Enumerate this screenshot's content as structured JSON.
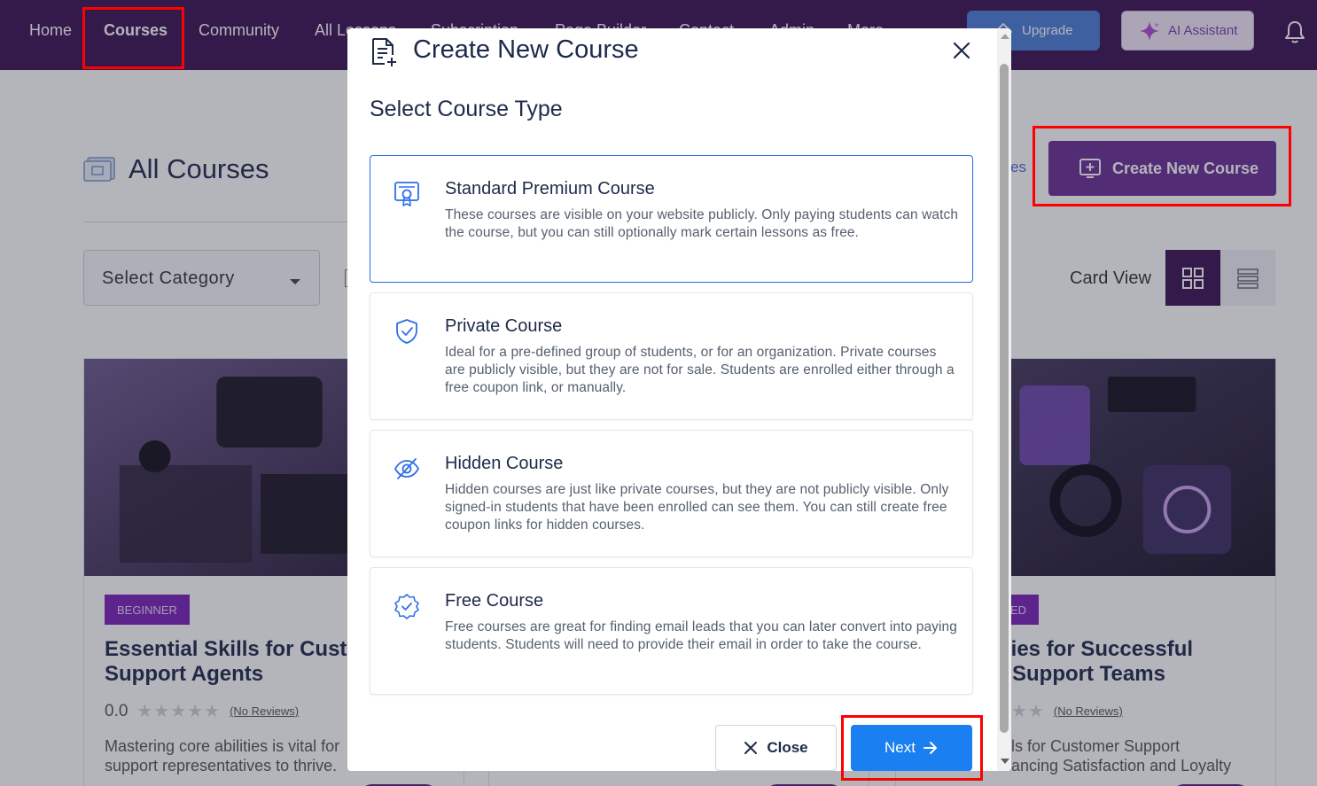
{
  "nav": {
    "items": [
      "Home",
      "Courses",
      "Community",
      "All Lessons",
      "Subscription",
      "Page Builder",
      "Contact",
      "Admin",
      "More"
    ],
    "upgrade_label": "Upgrade",
    "ai_label": "AI Assistant"
  },
  "page": {
    "title": "All Courses",
    "category_placeholder": "Select Category",
    "link_fragment": "es",
    "create_button": "Create New Course",
    "card_view_label": "Card View"
  },
  "cards": [
    {
      "badge": "BEGINNER",
      "title_line1": "Essential Skills for Cust",
      "title_line2": "Support Agents",
      "rating": "0.0",
      "reviews": "(No Reviews)",
      "desc_line1": "Mastering core abilities is vital for",
      "desc_line2": "support representatives to thrive."
    },
    {
      "badge": "ED",
      "title_line1": "ities for Successful",
      "title_line2": "r Support Teams",
      "reviews": "(No Reviews)",
      "desc_line1": "ls for Customer Support",
      "desc_line2": "ancing Satisfaction and Loyalty"
    }
  ],
  "modal": {
    "title": "Create New Course",
    "section_title": "Select Course Type",
    "options": [
      {
        "title": "Standard Premium Course",
        "desc": "These courses are visible on your website publicly. Only paying students can watch the course, but you can still optionally mark certain lessons as free.",
        "icon": "certificate-icon",
        "selected": true
      },
      {
        "title": "Private Course",
        "desc": "Ideal for a pre-defined group of students, or for an organization. Private courses are publicly visible, but they are not for sale. Students are enrolled either through a free coupon link, or manually.",
        "icon": "shield-check-icon",
        "selected": false
      },
      {
        "title": "Hidden Course",
        "desc": "Hidden courses are just like private courses, but they are not publicly visible. Only signed-in students that have been enrolled can see them. You can still create free coupon links for hidden courses.",
        "icon": "eye-off-icon",
        "selected": false
      },
      {
        "title": "Free Course",
        "desc": "Free courses are great for finding email leads that you can later convert into paying students. Students will need to provide their email in order to take the course.",
        "icon": "badge-check-icon",
        "selected": false
      }
    ],
    "close_label": "Close",
    "next_label": "Next"
  },
  "colors": {
    "nav_bg": "#3b1253",
    "primary_purple": "#6b2f96",
    "next_blue": "#1a7ff0",
    "selected_border": "#2e6fe8",
    "highlight_red": "#ff0000"
  }
}
